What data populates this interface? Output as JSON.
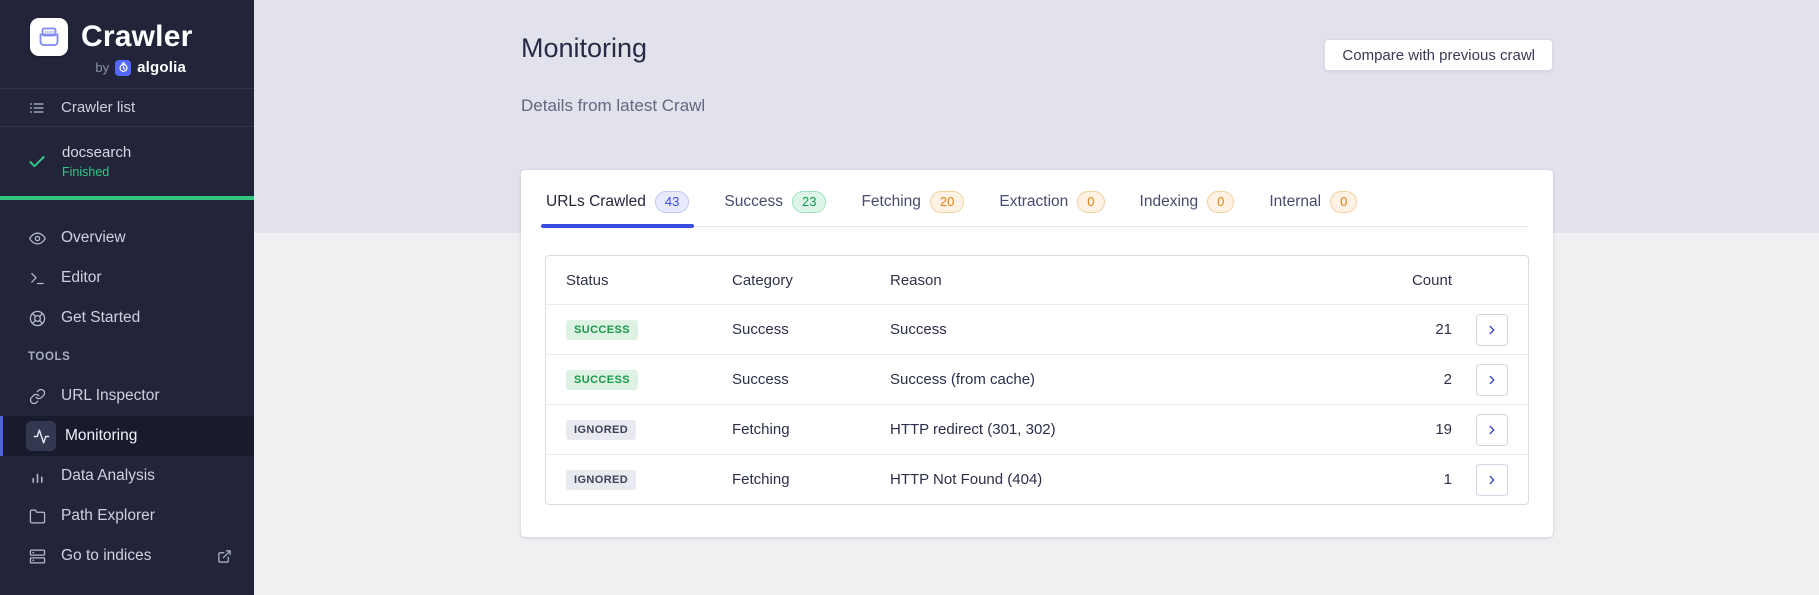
{
  "sidebar": {
    "logo": {
      "title": "Crawler",
      "by": "by",
      "brand": "algolia"
    },
    "crawler_list_label": "Crawler list",
    "crawl_status": {
      "name": "docsearch",
      "state": "Finished"
    },
    "nav": [
      {
        "label": "Overview"
      },
      {
        "label": "Editor"
      },
      {
        "label": "Get Started"
      }
    ],
    "tools_header": "TOOLS",
    "tools": [
      {
        "label": "URL Inspector"
      },
      {
        "label": "Monitoring",
        "active": true
      },
      {
        "label": "Data Analysis"
      },
      {
        "label": "Path Explorer"
      },
      {
        "label": "Go to indices",
        "external": true
      }
    ]
  },
  "header": {
    "title": "Monitoring",
    "subtitle": "Details from latest Crawl",
    "compare_button_label": "Compare with previous crawl"
  },
  "tabs": [
    {
      "label": "URLs Crawled",
      "count": "43",
      "badge_color": "blue",
      "active": true
    },
    {
      "label": "Success",
      "count": "23",
      "badge_color": "green",
      "active": false
    },
    {
      "label": "Fetching",
      "count": "20",
      "badge_color": "orange",
      "active": false
    },
    {
      "label": "Extraction",
      "count": "0",
      "badge_color": "orange",
      "active": false
    },
    {
      "label": "Indexing",
      "count": "0",
      "badge_color": "orange",
      "active": false
    },
    {
      "label": "Internal",
      "count": "0",
      "badge_color": "orange",
      "active": false
    }
  ],
  "table": {
    "columns": [
      "Status",
      "Category",
      "Reason",
      "Count"
    ],
    "rows": [
      {
        "status": "SUCCESS",
        "status_type": "success",
        "category": "Success",
        "reason": "Success",
        "count": "21"
      },
      {
        "status": "SUCCESS",
        "status_type": "success",
        "category": "Success",
        "reason": "Success (from cache)",
        "count": "2"
      },
      {
        "status": "IGNORED",
        "status_type": "ignored",
        "category": "Fetching",
        "reason": "HTTP redirect (301, 302)",
        "count": "19"
      },
      {
        "status": "IGNORED",
        "status_type": "ignored",
        "category": "Fetching",
        "reason": "HTTP Not Found (404)",
        "count": "1"
      }
    ]
  },
  "colors": {
    "sidebar_bg": "#22253a",
    "sidebar_active_accent": "#5361e6",
    "success_green": "#35c583",
    "tab_active_underline": "#3b4ce0",
    "badge_blue_text": "#3a4ce0",
    "badge_green_text": "#0f9d4d",
    "badge_orange_text": "#e0820f",
    "top_band_bg": "#e2e2ec",
    "page_bg": "#eff0f2",
    "algolia_blue": "#5468ff"
  }
}
